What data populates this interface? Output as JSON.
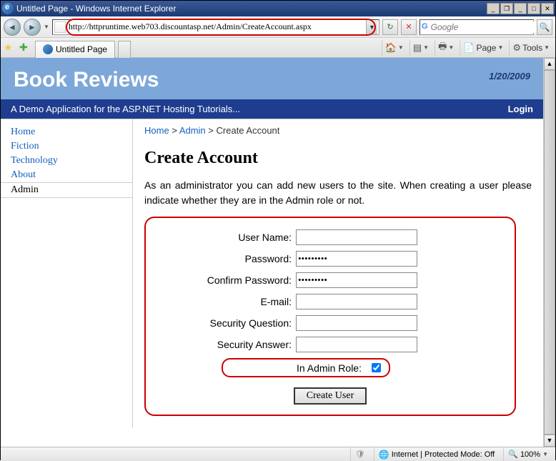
{
  "window": {
    "title": "Untitled Page - Windows Internet Explorer"
  },
  "address_bar": {
    "url": "http://httpruntime.web703.discountasp.net/Admin/CreateAccount.aspx"
  },
  "search": {
    "placeholder": "Google"
  },
  "tab": {
    "title": "Untitled Page"
  },
  "toolbar": {
    "page": "Page",
    "tools": "Tools"
  },
  "site": {
    "title": "Book Reviews",
    "date": "1/20/2009",
    "tagline": "A Demo Application for the ASP.NET Hosting Tutorials...",
    "login": "Login"
  },
  "sidebar": {
    "items": [
      "Home",
      "Fiction",
      "Technology",
      "About",
      "Admin"
    ],
    "active_index": 4
  },
  "breadcrumb": {
    "home": "Home",
    "admin": "Admin",
    "current": "Create Account",
    "sep": ">"
  },
  "page": {
    "heading": "Create Account",
    "intro": "As an administrator you can add new users to the site. When creating a user please indicate whether they are in the Admin role or not."
  },
  "form": {
    "username_label": "User Name:",
    "username_value": "",
    "password_label": "Password:",
    "password_value": "password1",
    "confirm_label": "Confirm Password:",
    "confirm_value": "password1",
    "email_label": "E-mail:",
    "email_value": "",
    "question_label": "Security Question:",
    "question_value": "",
    "answer_label": "Security Answer:",
    "answer_value": "",
    "admin_role_label": "In Admin Role:",
    "admin_role_checked": true,
    "submit_label": "Create User"
  },
  "status": {
    "zone": "Internet | Protected Mode: Off",
    "zoom": "100%"
  }
}
